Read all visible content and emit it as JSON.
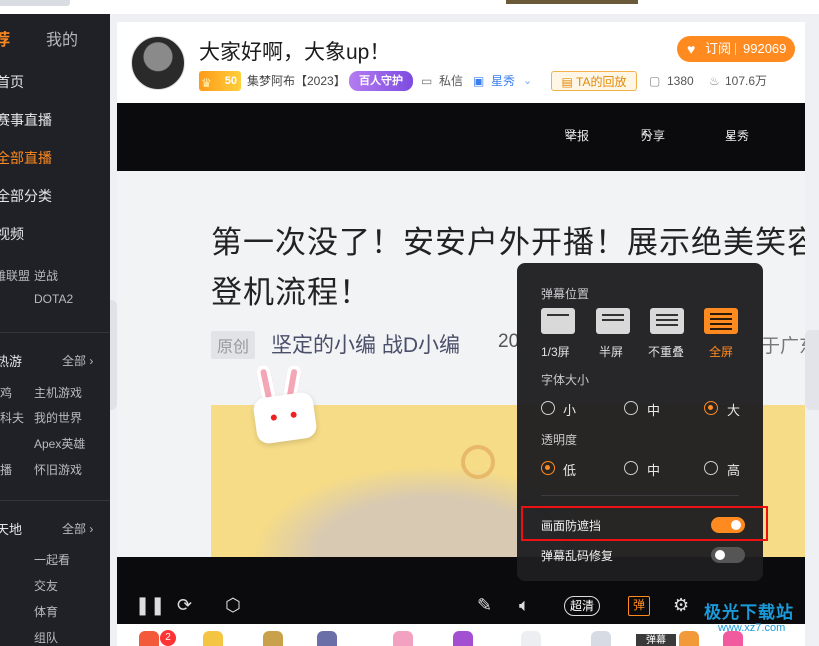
{
  "sidebar": {
    "tabs": [
      "荐",
      "我的"
    ],
    "nav": [
      "首页",
      "赛事直播",
      "全部直播",
      "全部分类",
      "视频"
    ],
    "games_row": [
      "英雄联盟",
      "逆战"
    ],
    "dota": "DOTA2",
    "hot_title": "热游",
    "hot_all": "全部",
    "hot_items": [
      [
        "吃鸡",
        "主机游戏"
      ],
      [
        "逃离塔科夫",
        "我的世界"
      ],
      [
        "",
        "Apex英雄"
      ],
      [
        "单机主播",
        "怀旧游戏"
      ]
    ],
    "world_title": "天地",
    "world_all": "全部",
    "world_items": [
      "一起看",
      "交友",
      "体育",
      "组队"
    ]
  },
  "header": {
    "title": "大家好啊，大象up！",
    "level": "50",
    "anchor": "集梦阿布【2023】",
    "guard": "百人守护",
    "message": "私信",
    "star": "星秀",
    "replay": "TA的回放",
    "heat": "1380",
    "fans": "107.6万",
    "subscribe_label": "订阅",
    "subscribe_count": "992069"
  },
  "player": {
    "report": "举报",
    "share": "分享",
    "category": "星秀",
    "video": {
      "headline1": "第一次没了！安安户外开播！展示绝美笑容",
      "headline2": "登机流程！",
      "original": "原创",
      "author": "坚定的小编  战D小编",
      "year": "20",
      "location": "于广东"
    },
    "quality": "超清",
    "danmu": "弹"
  },
  "popup": {
    "position_title": "弹幕位置",
    "positions": [
      "1/3屏",
      "半屏",
      "不重叠",
      "全屏"
    ],
    "selected_position": "全屏",
    "font_title": "字体大小",
    "font_sizes": [
      "小",
      "中",
      "大"
    ],
    "selected_font": "大",
    "opacity_title": "透明度",
    "opacities": [
      "低",
      "中",
      "高"
    ],
    "selected_opacity": "低",
    "anti_block": "画面防遮挡",
    "anti_block_on": true,
    "repair": "弹幕乱码修复",
    "repair_on": false
  },
  "gift_strip": {
    "badge": "2",
    "tooltip": "弹幕"
  },
  "watermark": {
    "title": "极光下载站",
    "url": "www.xz7.com"
  },
  "colors": {
    "accent": "#ff8a1f",
    "sidebar_bg": "#1f2127",
    "highlight": "#ee1111"
  }
}
